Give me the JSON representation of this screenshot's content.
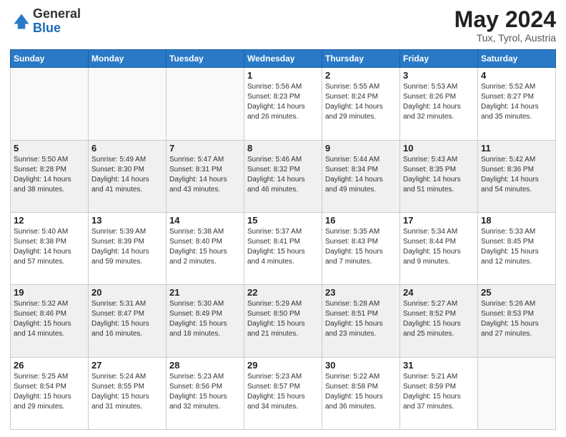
{
  "header": {
    "logo_line1": "General",
    "logo_line2": "Blue",
    "month_title": "May 2024",
    "location": "Tux, Tyrol, Austria"
  },
  "weekdays": [
    "Sunday",
    "Monday",
    "Tuesday",
    "Wednesday",
    "Thursday",
    "Friday",
    "Saturday"
  ],
  "weeks": [
    [
      {
        "day": "",
        "lines": []
      },
      {
        "day": "",
        "lines": []
      },
      {
        "day": "",
        "lines": []
      },
      {
        "day": "1",
        "lines": [
          "Sunrise: 5:56 AM",
          "Sunset: 8:23 PM",
          "Daylight: 14 hours",
          "and 26 minutes."
        ]
      },
      {
        "day": "2",
        "lines": [
          "Sunrise: 5:55 AM",
          "Sunset: 8:24 PM",
          "Daylight: 14 hours",
          "and 29 minutes."
        ]
      },
      {
        "day": "3",
        "lines": [
          "Sunrise: 5:53 AM",
          "Sunset: 8:26 PM",
          "Daylight: 14 hours",
          "and 32 minutes."
        ]
      },
      {
        "day": "4",
        "lines": [
          "Sunrise: 5:52 AM",
          "Sunset: 8:27 PM",
          "Daylight: 14 hours",
          "and 35 minutes."
        ]
      }
    ],
    [
      {
        "day": "5",
        "lines": [
          "Sunrise: 5:50 AM",
          "Sunset: 8:28 PM",
          "Daylight: 14 hours",
          "and 38 minutes."
        ]
      },
      {
        "day": "6",
        "lines": [
          "Sunrise: 5:49 AM",
          "Sunset: 8:30 PM",
          "Daylight: 14 hours",
          "and 41 minutes."
        ]
      },
      {
        "day": "7",
        "lines": [
          "Sunrise: 5:47 AM",
          "Sunset: 8:31 PM",
          "Daylight: 14 hours",
          "and 43 minutes."
        ]
      },
      {
        "day": "8",
        "lines": [
          "Sunrise: 5:46 AM",
          "Sunset: 8:32 PM",
          "Daylight: 14 hours",
          "and 46 minutes."
        ]
      },
      {
        "day": "9",
        "lines": [
          "Sunrise: 5:44 AM",
          "Sunset: 8:34 PM",
          "Daylight: 14 hours",
          "and 49 minutes."
        ]
      },
      {
        "day": "10",
        "lines": [
          "Sunrise: 5:43 AM",
          "Sunset: 8:35 PM",
          "Daylight: 14 hours",
          "and 51 minutes."
        ]
      },
      {
        "day": "11",
        "lines": [
          "Sunrise: 5:42 AM",
          "Sunset: 8:36 PM",
          "Daylight: 14 hours",
          "and 54 minutes."
        ]
      }
    ],
    [
      {
        "day": "12",
        "lines": [
          "Sunrise: 5:40 AM",
          "Sunset: 8:38 PM",
          "Daylight: 14 hours",
          "and 57 minutes."
        ]
      },
      {
        "day": "13",
        "lines": [
          "Sunrise: 5:39 AM",
          "Sunset: 8:39 PM",
          "Daylight: 14 hours",
          "and 59 minutes."
        ]
      },
      {
        "day": "14",
        "lines": [
          "Sunrise: 5:38 AM",
          "Sunset: 8:40 PM",
          "Daylight: 15 hours",
          "and 2 minutes."
        ]
      },
      {
        "day": "15",
        "lines": [
          "Sunrise: 5:37 AM",
          "Sunset: 8:41 PM",
          "Daylight: 15 hours",
          "and 4 minutes."
        ]
      },
      {
        "day": "16",
        "lines": [
          "Sunrise: 5:35 AM",
          "Sunset: 8:43 PM",
          "Daylight: 15 hours",
          "and 7 minutes."
        ]
      },
      {
        "day": "17",
        "lines": [
          "Sunrise: 5:34 AM",
          "Sunset: 8:44 PM",
          "Daylight: 15 hours",
          "and 9 minutes."
        ]
      },
      {
        "day": "18",
        "lines": [
          "Sunrise: 5:33 AM",
          "Sunset: 8:45 PM",
          "Daylight: 15 hours",
          "and 12 minutes."
        ]
      }
    ],
    [
      {
        "day": "19",
        "lines": [
          "Sunrise: 5:32 AM",
          "Sunset: 8:46 PM",
          "Daylight: 15 hours",
          "and 14 minutes."
        ]
      },
      {
        "day": "20",
        "lines": [
          "Sunrise: 5:31 AM",
          "Sunset: 8:47 PM",
          "Daylight: 15 hours",
          "and 16 minutes."
        ]
      },
      {
        "day": "21",
        "lines": [
          "Sunrise: 5:30 AM",
          "Sunset: 8:49 PM",
          "Daylight: 15 hours",
          "and 18 minutes."
        ]
      },
      {
        "day": "22",
        "lines": [
          "Sunrise: 5:29 AM",
          "Sunset: 8:50 PM",
          "Daylight: 15 hours",
          "and 21 minutes."
        ]
      },
      {
        "day": "23",
        "lines": [
          "Sunrise: 5:28 AM",
          "Sunset: 8:51 PM",
          "Daylight: 15 hours",
          "and 23 minutes."
        ]
      },
      {
        "day": "24",
        "lines": [
          "Sunrise: 5:27 AM",
          "Sunset: 8:52 PM",
          "Daylight: 15 hours",
          "and 25 minutes."
        ]
      },
      {
        "day": "25",
        "lines": [
          "Sunrise: 5:26 AM",
          "Sunset: 8:53 PM",
          "Daylight: 15 hours",
          "and 27 minutes."
        ]
      }
    ],
    [
      {
        "day": "26",
        "lines": [
          "Sunrise: 5:25 AM",
          "Sunset: 8:54 PM",
          "Daylight: 15 hours",
          "and 29 minutes."
        ]
      },
      {
        "day": "27",
        "lines": [
          "Sunrise: 5:24 AM",
          "Sunset: 8:55 PM",
          "Daylight: 15 hours",
          "and 31 minutes."
        ]
      },
      {
        "day": "28",
        "lines": [
          "Sunrise: 5:23 AM",
          "Sunset: 8:56 PM",
          "Daylight: 15 hours",
          "and 32 minutes."
        ]
      },
      {
        "day": "29",
        "lines": [
          "Sunrise: 5:23 AM",
          "Sunset: 8:57 PM",
          "Daylight: 15 hours",
          "and 34 minutes."
        ]
      },
      {
        "day": "30",
        "lines": [
          "Sunrise: 5:22 AM",
          "Sunset: 8:58 PM",
          "Daylight: 15 hours",
          "and 36 minutes."
        ]
      },
      {
        "day": "31",
        "lines": [
          "Sunrise: 5:21 AM",
          "Sunset: 8:59 PM",
          "Daylight: 15 hours",
          "and 37 minutes."
        ]
      },
      {
        "day": "",
        "lines": []
      }
    ]
  ]
}
